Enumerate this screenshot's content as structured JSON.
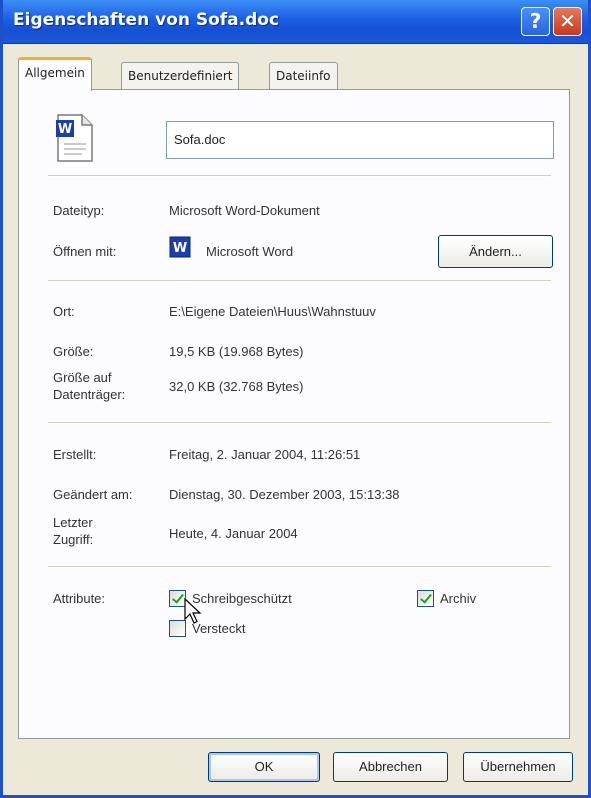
{
  "window": {
    "title": "Eigenschaften von Sofa.doc",
    "help_glyph": "?",
    "close_glyph": "✕"
  },
  "tabs": [
    {
      "label": "Allgemein",
      "active": true
    },
    {
      "label": "Benutzerdefiniert",
      "active": false
    },
    {
      "label": "Dateiinfo",
      "active": false
    }
  ],
  "general": {
    "filename": "Sofa.doc",
    "dateityp_label": "Dateityp:",
    "dateityp_value": "Microsoft Word-Dokument",
    "oeffnen_label": "Öffnen mit:",
    "oeffnen_value": "Microsoft Word",
    "aendern_button": "Ändern...",
    "ort_label": "Ort:",
    "ort_value": "E:\\Eigene Dateien\\Huus\\Wahnstuuv",
    "groesse_label": "Größe:",
    "groesse_value": "19,5 KB (19.968 Bytes)",
    "groesse_dt_label_1": "Größe auf",
    "groesse_dt_label_2": "Datenträger:",
    "groesse_dt_value": "32,0 KB (32.768 Bytes)",
    "erstellt_label": "Erstellt:",
    "erstellt_value": "Freitag, 2. Januar 2004, 11:26:51",
    "geaendert_label": "Geändert am:",
    "geaendert_value": "Dienstag, 30. Dezember 2003, 15:13:38",
    "zugriff_label_1": "Letzter",
    "zugriff_label_2": "Zugriff:",
    "zugriff_value": "Heute, 4. Januar 2004",
    "attribute_label": "Attribute:"
  },
  "attributes": [
    {
      "label": "Schreibgeschützt",
      "checked": true
    },
    {
      "label": "Archiv",
      "checked": true
    },
    {
      "label": "Versteckt",
      "checked": false
    }
  ],
  "buttons": {
    "ok": "OK",
    "cancel": "Abbrechen",
    "apply": "Übernehmen"
  },
  "icons": {
    "document": "word-document-icon",
    "app": "word-app-icon",
    "cursor": "mouse-cursor-icon"
  },
  "colors": {
    "titlebar": "#1b5fe3",
    "dialog_bg": "#ece9d8",
    "active_tab_accent": "#f0b030",
    "check": "#21a121"
  }
}
